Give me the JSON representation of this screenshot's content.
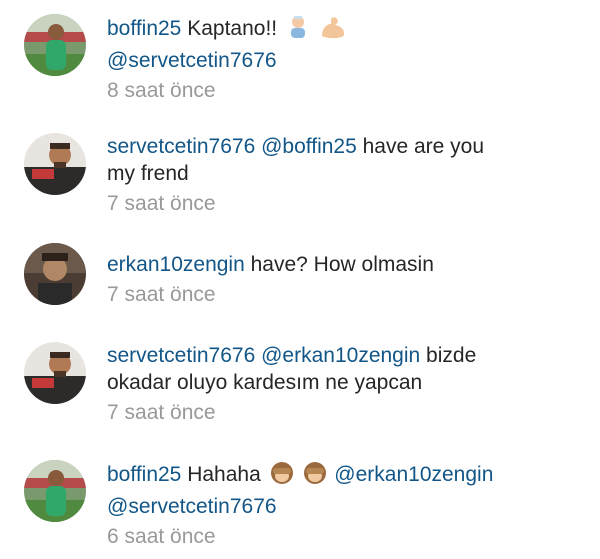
{
  "comments": [
    {
      "user": "boffin25",
      "text": "Kaptano!!",
      "emojis": [
        "baby-bottle-emoji",
        "flexed-biceps-emoji"
      ],
      "mention_lines": [
        "@servetcetin7676"
      ],
      "time": "8 saat önce"
    },
    {
      "user": "servetcetin7676",
      "mention": "@boffin25",
      "text1": "have are you",
      "text2": "my frend",
      "time": "7 saat önce"
    },
    {
      "user": "erkan10zengin",
      "text": "have?  How olmasin",
      "time": "7 saat önce"
    },
    {
      "user": "servetcetin7676",
      "mention": "@erkan10zengin",
      "text1": "bizde",
      "text2": "okadar oluyo kardesım ne yapcan",
      "time": "7 saat önce"
    },
    {
      "user": "boffin25",
      "text": "Hahaha",
      "emojis": [
        "see-no-evil-monkey-emoji",
        "see-no-evil-monkey-emoji"
      ],
      "mention": "@erkan10zengin",
      "mention2": "@servetcetin7676",
      "time": "6 saat önce"
    }
  ],
  "colors": {
    "username": "#125688",
    "text": "#262626",
    "time": "#999999"
  }
}
